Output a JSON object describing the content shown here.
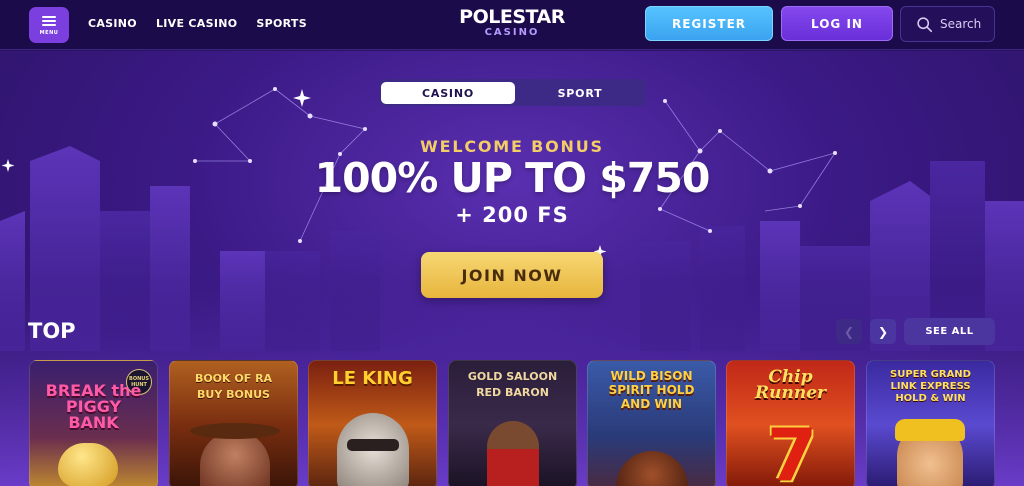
{
  "header": {
    "menu_label": "MENU",
    "nav": [
      "CASINO",
      "LIVE CASINO",
      "SPORTS"
    ],
    "logo_main": "POLESTAR",
    "logo_sub": "CASINO",
    "register": "REGISTER",
    "login": "LOG IN",
    "search_placeholder": "Search"
  },
  "hero": {
    "tabs": [
      "CASINO",
      "SPORT"
    ],
    "active_tab": "CASINO",
    "welcome": "WELCOME BONUS",
    "headline": "100% UP TO $750",
    "subline": "+ 200 FS",
    "cta": "JOIN NOW"
  },
  "top": {
    "title": "TOP",
    "see_all": "SEE ALL",
    "prev_icon": "chevron-left-icon",
    "next_icon": "chevron-right-icon",
    "games": [
      {
        "name": "BREAK the PIGGY BANK",
        "badge": "BONUS HUNT"
      },
      {
        "name": "BOOK OF RA BUY BONUS"
      },
      {
        "name": "LE KING"
      },
      {
        "name": "GOLD SALOON RED BARON"
      },
      {
        "name": "WILD BISON SPIRIT HOLD AND WIN"
      },
      {
        "name": "Chip Runner"
      },
      {
        "name": "SUPER GRAND LINK EXPRESS HOLD & WIN"
      }
    ]
  },
  "colors": {
    "accent_blue": "#3aa2f0",
    "accent_purple": "#6a2fd8",
    "cta_gold": "#e7b53c",
    "welcome_gold": "#f3cd66"
  }
}
